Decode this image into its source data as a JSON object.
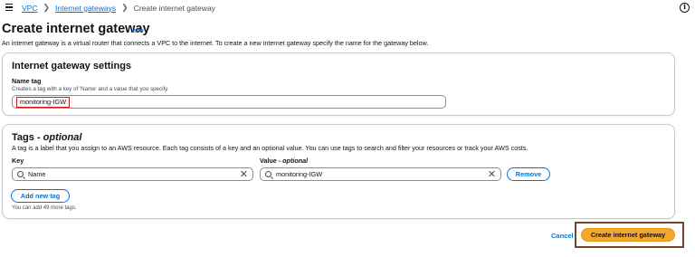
{
  "breadcrumb": {
    "items": [
      "VPC",
      "Internet gateways"
    ],
    "current": "Create internet gateway"
  },
  "header": {
    "title": "Create internet gateway",
    "info_label": "Info",
    "description": "An internet gateway is a virtual router that connects a VPC to the internet. To create a new internet gateway specify the name for the gateway below."
  },
  "settings": {
    "heading": "Internet gateway settings",
    "name_tag": {
      "label": "Name tag",
      "description": "Creates a tag with a key of 'Name' and a value that you specify.",
      "value": "monitoring-IGW"
    }
  },
  "tags": {
    "heading": "Tags",
    "heading_suffix": "optional",
    "description": "A tag is a label that you assign to an AWS resource. Each tag consists of a key and an optional value. You can use tags to search and filter your resources or track your AWS costs.",
    "key_label": "Key",
    "value_label": "Value - optional",
    "rows": [
      {
        "key": "Name",
        "value": "monitoring-IGW"
      }
    ],
    "remove_label": "Remove",
    "add_label": "Add new tag",
    "limit_note": "You can add 49 more tags."
  },
  "footer": {
    "cancel_label": "Cancel",
    "create_label": "Create internet gateway"
  },
  "colors": {
    "link": "#0972d3",
    "primary_button": "#f2a72e",
    "highlight_red": "#d91515",
    "highlight_brown": "#7a4424"
  },
  "icons": [
    "menu-icon",
    "info-circle-icon",
    "chevron-right-icon",
    "search-icon",
    "clear-icon"
  ]
}
